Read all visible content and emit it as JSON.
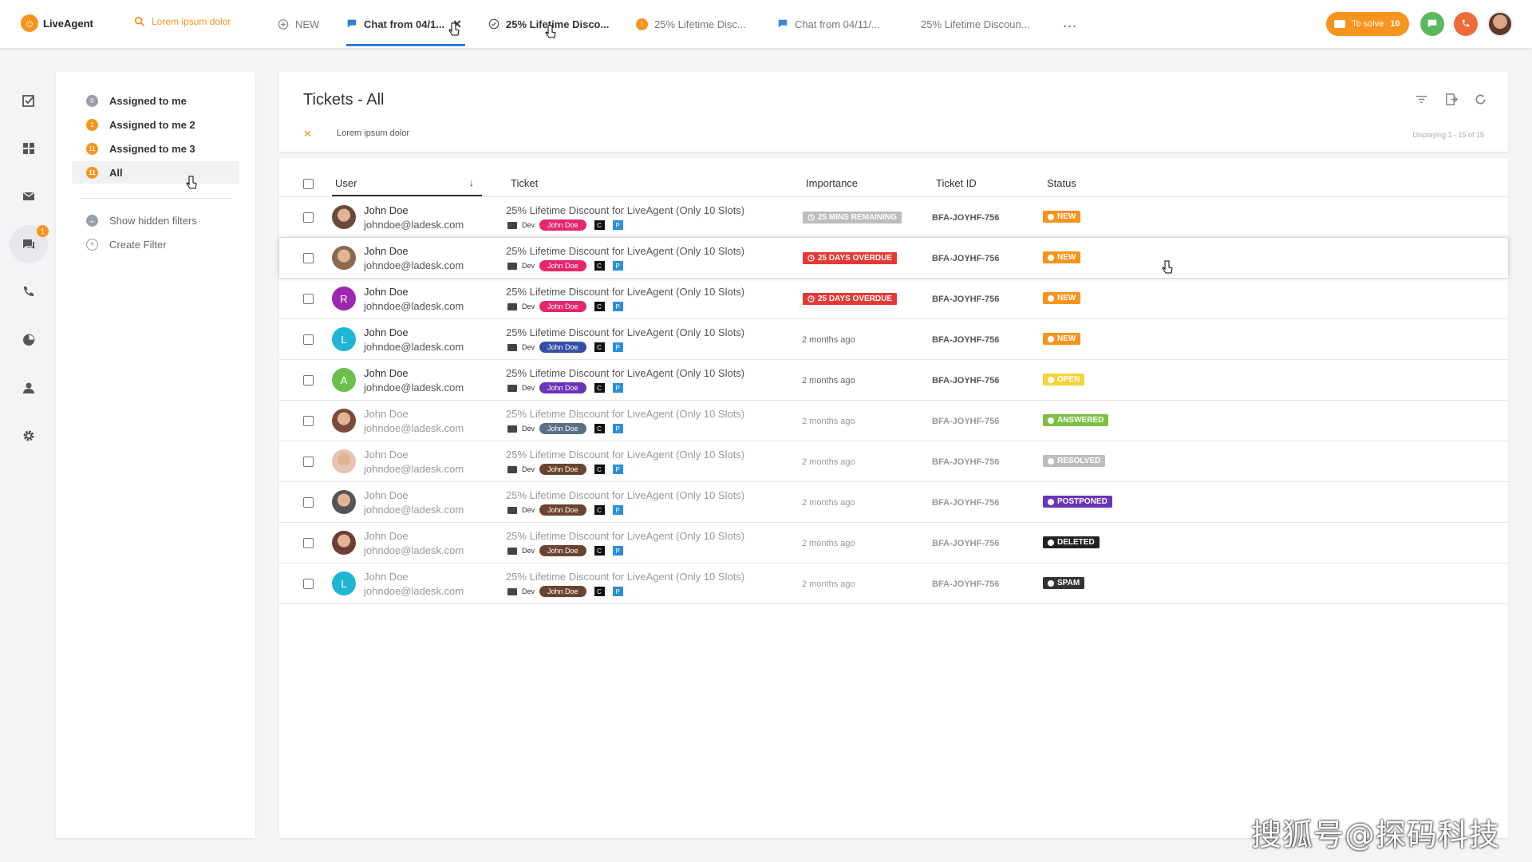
{
  "app": {
    "name": "LiveAgent"
  },
  "search": {
    "placeholder": "Lorem ipsum dolor"
  },
  "tabs": [
    {
      "label": "NEW",
      "icon": "plus-circle-icon"
    },
    {
      "label": "Chat from 04/1...",
      "icon": "chat-icon",
      "active": true
    },
    {
      "label": "25% Lifetime Disco...",
      "icon": "check-circle-icon"
    },
    {
      "label": "25% Lifetime Disc...",
      "icon": "notification-dot-icon",
      "badge": "!"
    },
    {
      "label": "Chat from 04/11/...",
      "icon": "chat-icon"
    },
    {
      "label": "25% Lifetime Discoun..."
    }
  ],
  "more_label": "...",
  "header_right": {
    "to_solve_label": "To solve",
    "to_solve_count": "10"
  },
  "nav": {
    "mail_badge": "1"
  },
  "filters": {
    "items": [
      {
        "label": "Assigned to me",
        "badge": "0",
        "badge_color": "#9aa0a6"
      },
      {
        "label": "Assigned to me 2",
        "badge": "1",
        "badge_color": "#f7941d"
      },
      {
        "label": "Assigned to me 3",
        "badge": "11",
        "badge_color": "#f7941d"
      },
      {
        "label": "All",
        "badge": "11",
        "badge_color": "#f7941d",
        "selected": true
      }
    ],
    "show_hidden": "Show hidden filters",
    "create": "Create Filter"
  },
  "main": {
    "title": "Tickets - All",
    "active_filter": "Lorem ipsum dolor",
    "displaying": "Displaying 1 - 15 of 15"
  },
  "table": {
    "headers": {
      "user": "User",
      "ticket": "Ticket",
      "importance": "Importance",
      "ticket_id": "Ticket ID",
      "status": "Status"
    },
    "rows": [
      {
        "name": "John Doe",
        "email": "johndoe@ladesk.com",
        "avatar": "photo-1",
        "avatar_letter": "",
        "avatar_color": "#6b4a3a",
        "ticket": "25% Lifetime Discount for LiveAgent (Only 10 Slots)",
        "dept": "Dev",
        "agent": "John Doe",
        "agent_color": "#e6266f",
        "tag_c": "C",
        "tag_p": "P",
        "importance": "25 MINS REMAINING",
        "importance_color": "#bdbdbd",
        "ticket_id": "BFA-JOYHF-756",
        "status": "NEW",
        "status_color": "#f7941d",
        "dim": false
      },
      {
        "name": "John Doe",
        "email": "johndoe@ladesk.com",
        "avatar": "photo-2",
        "avatar_letter": "",
        "avatar_color": "#8a6a50",
        "ticket": "25% Lifetime Discount for LiveAgent (Only 10 Slots)",
        "dept": "Dev",
        "agent": "John Doe",
        "agent_color": "#e6266f",
        "tag_c": "C",
        "tag_p": "P",
        "importance": "25 DAYS OVERDUE",
        "importance_color": "#e53935",
        "ticket_id": "BFA-JOYHF-756",
        "status": "NEW",
        "status_color": "#f7941d",
        "dim": false
      },
      {
        "name": "John Doe",
        "email": "johndoe@ladesk.com",
        "avatar": "letter",
        "avatar_letter": "R",
        "avatar_color": "#9c27b0",
        "ticket": "25% Lifetime Discount for LiveAgent (Only 10 Slots)",
        "dept": "Dev",
        "agent": "John Doe",
        "agent_color": "#e6266f",
        "tag_c": "C",
        "tag_p": "P",
        "importance": "25 DAYS OVERDUE",
        "importance_color": "#e53935",
        "ticket_id": "BFA-JOYHF-756",
        "status": "NEW",
        "status_color": "#f7941d",
        "dim": false
      },
      {
        "name": "John Doe",
        "email": "johndoe@ladesk.com",
        "avatar": "letter",
        "avatar_letter": "L",
        "avatar_color": "#1fb6d4",
        "ticket": "25% Lifetime Discount for LiveAgent (Only 10 Slots)",
        "dept": "Dev",
        "agent": "John Doe",
        "agent_color": "#3550a8",
        "tag_c": "C",
        "tag_p": "P",
        "importance": "2 months ago",
        "importance_color": "",
        "ticket_id": "BFA-JOYHF-756",
        "status": "NEW",
        "status_color": "#f7941d",
        "dim": false
      },
      {
        "name": "John Doe",
        "email": "johndoe@ladesk.com",
        "avatar": "letter",
        "avatar_letter": "A",
        "avatar_color": "#6cbf4a",
        "ticket": "25% Lifetime Discount for LiveAgent (Only 10 Slots)",
        "dept": "Dev",
        "agent": "John Doe",
        "agent_color": "#6a35b8",
        "tag_c": "C",
        "tag_p": "P",
        "importance": "2 months ago",
        "importance_color": "",
        "ticket_id": "BFA-JOYHF-756",
        "status": "OPEN",
        "status_color": "#f5d33a",
        "dim": false
      },
      {
        "name": "John Doe",
        "email": "johndoe@ladesk.com",
        "avatar": "photo-3",
        "avatar_letter": "",
        "avatar_color": "#7a4a3a",
        "ticket": "25% Lifetime Discount for LiveAgent (Only 10 Slots)",
        "dept": "Dev",
        "agent": "John Doe",
        "agent_color": "#5b7083",
        "tag_c": "C",
        "tag_p": "P",
        "importance": "2 months ago",
        "importance_color": "",
        "ticket_id": "BFA-JOYHF-756",
        "status": "ANSWERED",
        "status_color": "#7cc142",
        "dim": true
      },
      {
        "name": "John Doe",
        "email": "johndoe@ladesk.com",
        "avatar": "photo-4",
        "avatar_letter": "",
        "avatar_color": "#e7c1b1",
        "ticket": "25% Lifetime Discount for LiveAgent (Only 10 Slots)",
        "dept": "Dev",
        "agent": "John Doe",
        "agent_color": "#6b4430",
        "tag_c": "C",
        "tag_p": "P",
        "importance": "2 months ago",
        "importance_color": "",
        "ticket_id": "BFA-JOYHF-756",
        "status": "RESOLVED",
        "status_color": "#bdbdbd",
        "dim": true
      },
      {
        "name": "John Doe",
        "email": "johndoe@ladesk.com",
        "avatar": "photo-5",
        "avatar_letter": "",
        "avatar_color": "#555555",
        "ticket": "25% Lifetime Discount for LiveAgent (Only 10 Slots)",
        "dept": "Dev",
        "agent": "John Doe",
        "agent_color": "#6b4430",
        "tag_c": "C",
        "tag_p": "P",
        "importance": "2 months ago",
        "importance_color": "",
        "ticket_id": "BFA-JOYHF-756",
        "status": "POSTPONED",
        "status_color": "#6a35b8",
        "dim": true
      },
      {
        "name": "John Doe",
        "email": "johndoe@ladesk.com",
        "avatar": "photo-6",
        "avatar_letter": "",
        "avatar_color": "#6e3e34",
        "ticket": "25% Lifetime Discount for LiveAgent (Only 10 Slots)",
        "dept": "Dev",
        "agent": "John Doe",
        "agent_color": "#6b4430",
        "tag_c": "C",
        "tag_p": "P",
        "importance": "2 months ago",
        "importance_color": "",
        "ticket_id": "BFA-JOYHF-756",
        "status": "DELETED",
        "status_color": "#222222",
        "dim": true
      },
      {
        "name": "John Doe",
        "email": "johndoe@ladesk.com",
        "avatar": "letter",
        "avatar_letter": "L",
        "avatar_color": "#1fb6d4",
        "ticket": "25% Lifetime Discount for LiveAgent (Only 10 Slots)",
        "dept": "Dev",
        "agent": "John Doe",
        "agent_color": "#6b4430",
        "tag_c": "C",
        "tag_p": "P",
        "importance": "2 months ago",
        "importance_color": "",
        "ticket_id": "BFA-JOYHF-756",
        "status": "SPAM",
        "status_color": "#333333",
        "dim": true
      }
    ]
  },
  "watermark": "搜狐号@探码科技"
}
